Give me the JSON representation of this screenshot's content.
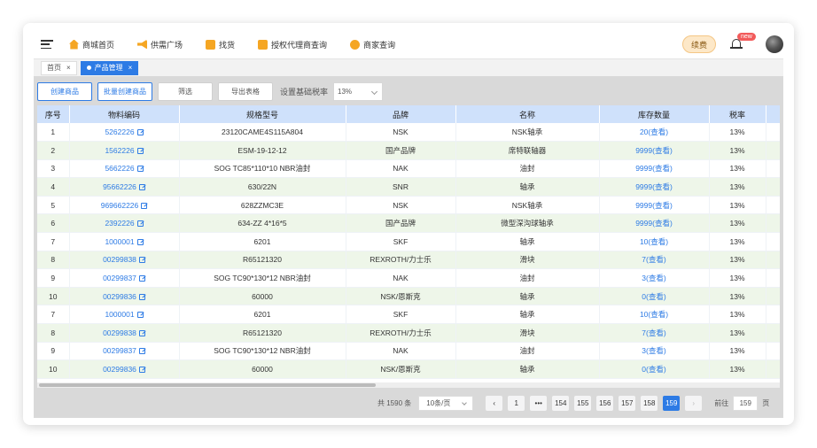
{
  "nav": {
    "items": [
      {
        "label": "商城首页",
        "icon": "house-icon"
      },
      {
        "label": "供需广场",
        "icon": "horn-icon"
      },
      {
        "label": "找货",
        "icon": "search-icon"
      },
      {
        "label": "授权代理商查询",
        "icon": "document-icon"
      },
      {
        "label": "商家查询",
        "icon": "shop-icon"
      }
    ],
    "renew_label": "续费",
    "badge": "new"
  },
  "tabs": [
    {
      "label": "首页",
      "close": "×"
    },
    {
      "label": "产品管理",
      "close": "×"
    }
  ],
  "toolbar": {
    "create_label": "创建商品",
    "batch_create_label": "批量创建商品",
    "filter_label": "筛选",
    "export_label": "导出表格",
    "tax_label": "设置基础税率",
    "tax_value": "13%"
  },
  "table": {
    "headers": [
      "序号",
      "物料编码",
      "规格型号",
      "品牌",
      "名称",
      "库存数量",
      "税率"
    ],
    "rows": [
      {
        "idx": "1",
        "code": "5262226",
        "spec": "23120CAME4S115A804",
        "brand": "NSK",
        "name": "NSK轴承",
        "stock": "20(查看)",
        "tax": "13%"
      },
      {
        "idx": "2",
        "code": "1562226",
        "spec": "ESM-19-12-12",
        "brand": "国产品牌",
        "name": "席特联轴器",
        "stock": "9999(查看)",
        "tax": "13%"
      },
      {
        "idx": "3",
        "code": "5662226",
        "spec": "SOG TC85*110*10 NBR油封",
        "brand": "NAK",
        "name": "油封",
        "stock": "9999(查看)",
        "tax": "13%"
      },
      {
        "idx": "4",
        "code": "95662226",
        "spec": "630/22N",
        "brand": "SNR",
        "name": "轴承",
        "stock": "9999(查看)",
        "tax": "13%"
      },
      {
        "idx": "5",
        "code": "969662226",
        "spec": "628ZZMC3E",
        "brand": "NSK",
        "name": "NSK轴承",
        "stock": "9999(查看)",
        "tax": "13%"
      },
      {
        "idx": "6",
        "code": "2392226",
        "spec": "634-ZZ 4*16*5",
        "brand": "国产品牌",
        "name": "微型深沟球轴承",
        "stock": "9999(查看)",
        "tax": "13%"
      },
      {
        "idx": "7",
        "code": "1000001",
        "spec": "6201",
        "brand": "SKF",
        "name": "轴承",
        "stock": "10(查看)",
        "tax": "13%"
      },
      {
        "idx": "8",
        "code": "00299838",
        "spec": "R65121320",
        "brand": "REXROTH/力士乐",
        "name": "滑块",
        "stock": "7(查看)",
        "tax": "13%"
      },
      {
        "idx": "9",
        "code": "00299837",
        "spec": "SOG TC90*130*12 NBR油封",
        "brand": "NAK",
        "name": "油封",
        "stock": "3(查看)",
        "tax": "13%"
      },
      {
        "idx": "10",
        "code": "00299836",
        "spec": "60000",
        "brand": "NSK/恩斯克",
        "name": "轴承",
        "stock": "0(查看)",
        "tax": "13%"
      },
      {
        "idx": "7",
        "code": "1000001",
        "spec": "6201",
        "brand": "SKF",
        "name": "轴承",
        "stock": "10(查看)",
        "tax": "13%"
      },
      {
        "idx": "8",
        "code": "00299838",
        "spec": "R65121320",
        "brand": "REXROTH/力士乐",
        "name": "滑块",
        "stock": "7(查看)",
        "tax": "13%"
      },
      {
        "idx": "9",
        "code": "00299837",
        "spec": "SOG TC90*130*12 NBR油封",
        "brand": "NAK",
        "name": "油封",
        "stock": "3(查看)",
        "tax": "13%"
      },
      {
        "idx": "10",
        "code": "00299836",
        "spec": "60000",
        "brand": "NSK/恩斯克",
        "name": "轴承",
        "stock": "0(查看)",
        "tax": "13%"
      }
    ]
  },
  "pagination": {
    "total": "共 1590 条",
    "page_size": "10条/页",
    "prev": "‹",
    "next": "›",
    "pages": [
      "1",
      "•••",
      "154",
      "155",
      "156",
      "157",
      "158",
      "159"
    ],
    "current": "159",
    "goto_prefix": "前往",
    "goto_value": "159",
    "goto_suffix": "页"
  },
  "colors": {
    "accent": "#2d7be5",
    "header_bg": "#cfe1fb",
    "even_row": "#eef6e9",
    "renew_bg": "#fde8c8",
    "badge": "#f25b5b"
  }
}
